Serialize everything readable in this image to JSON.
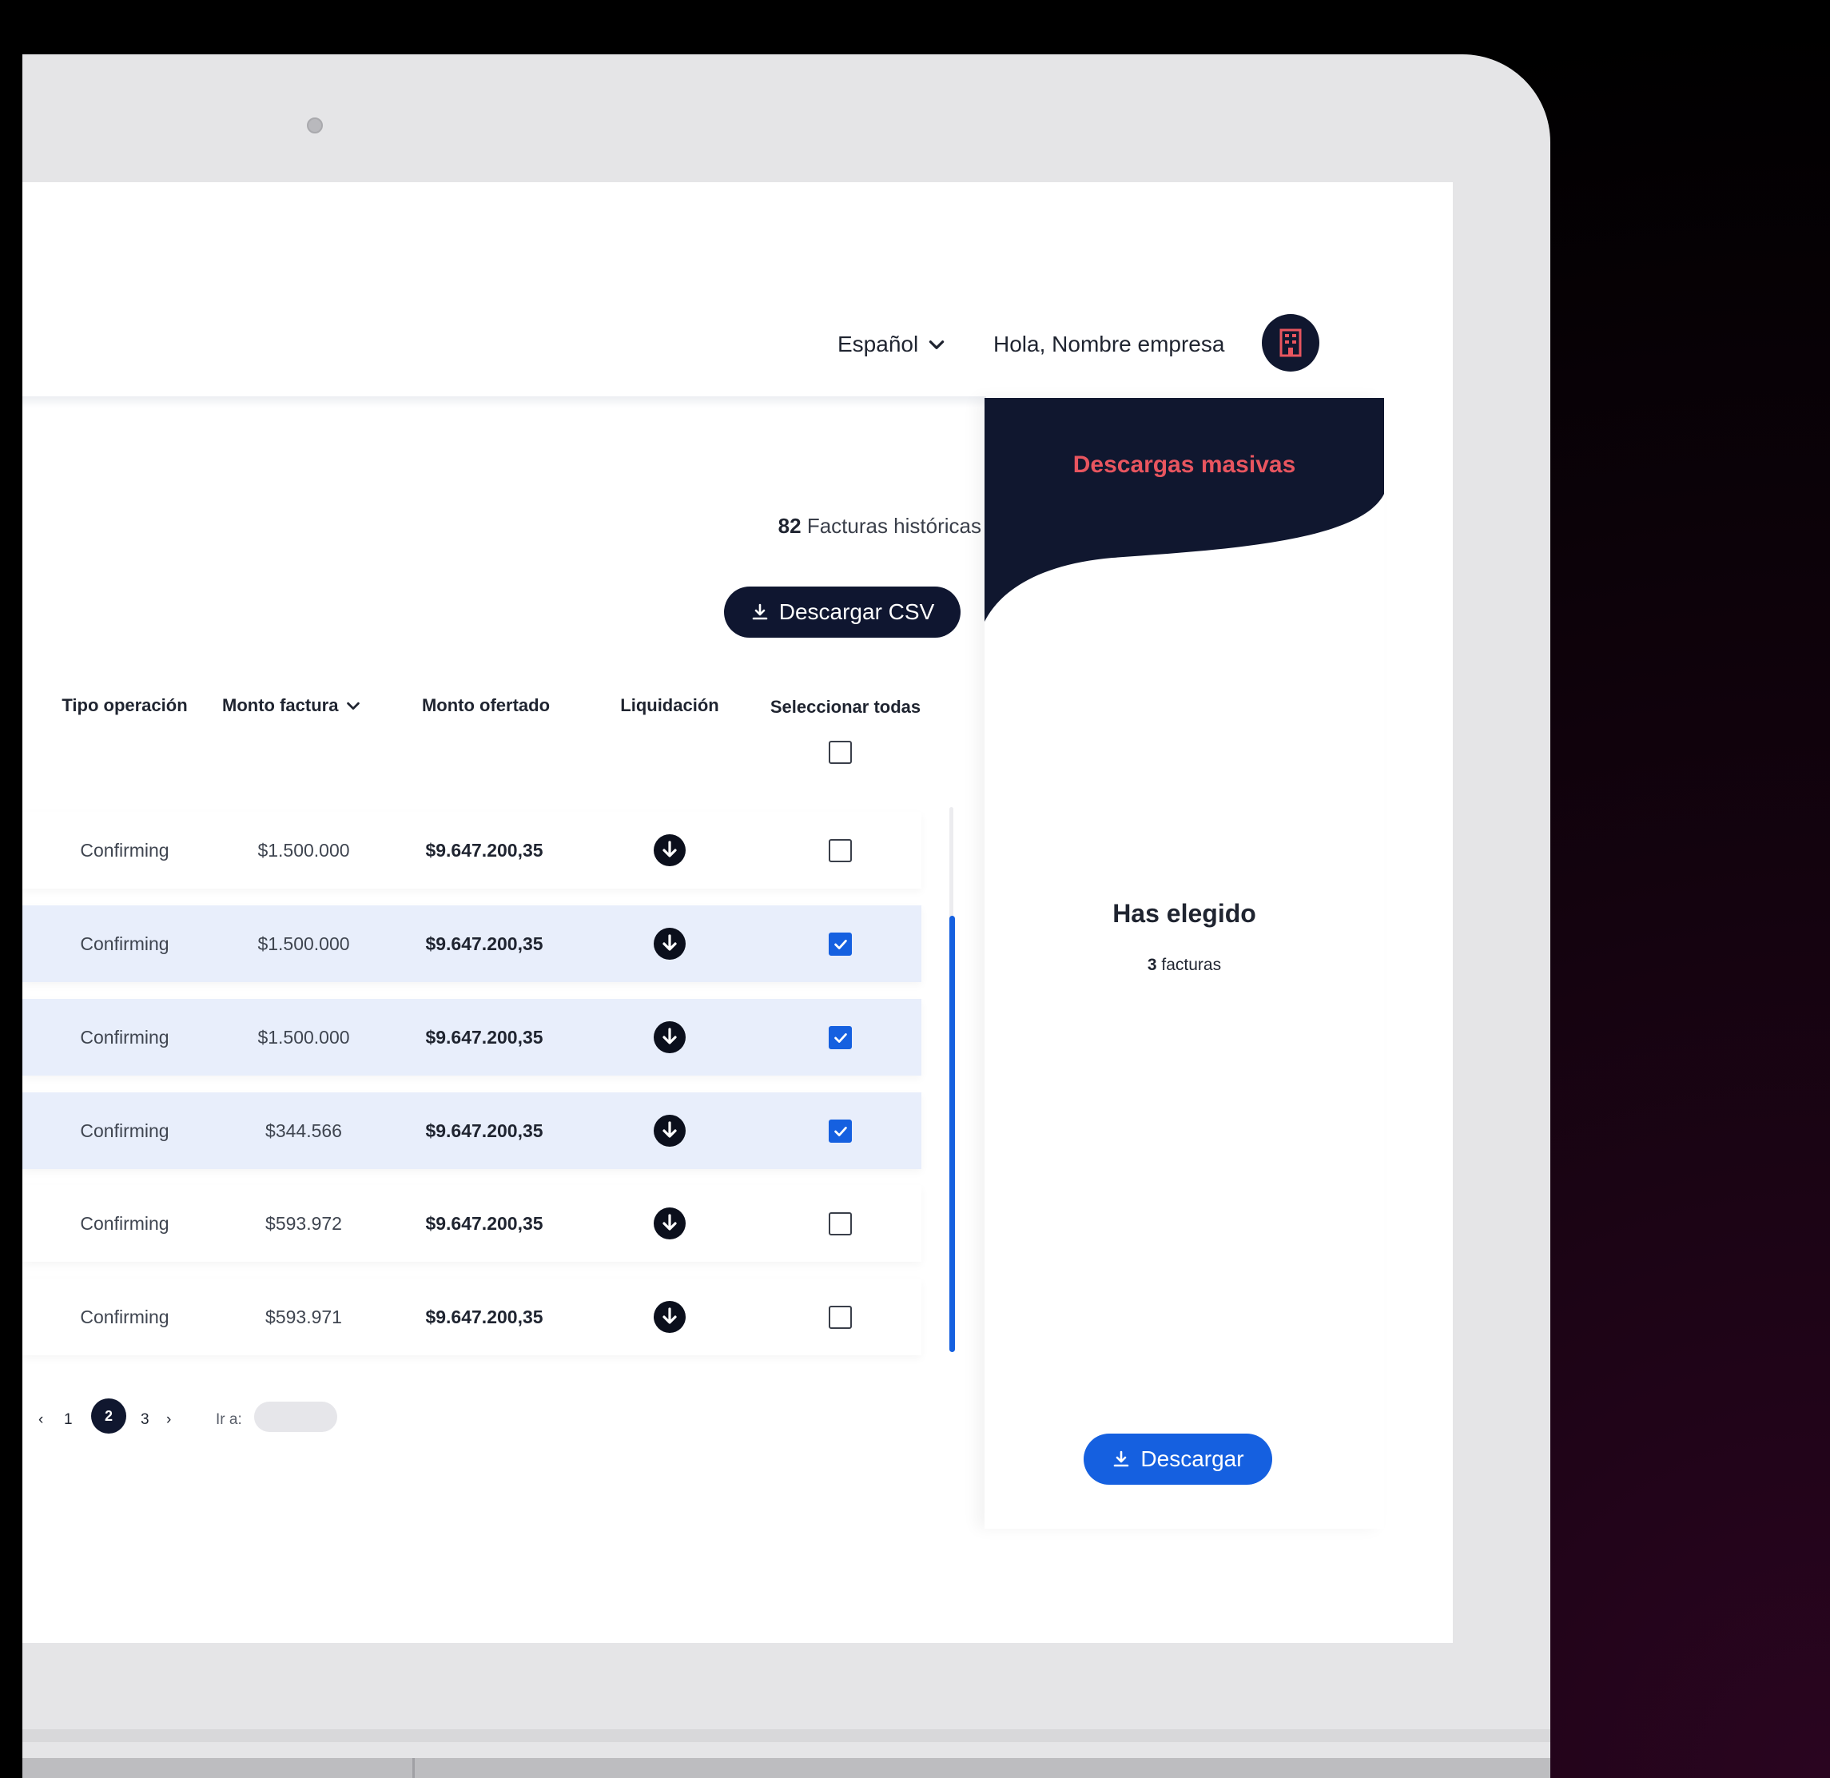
{
  "header": {
    "language": "Español",
    "greeting": "Hola, Nombre empresa"
  },
  "summary": {
    "count": "82",
    "count_label": "Facturas históricas",
    "csv_button": "Descargar CSV"
  },
  "table": {
    "columns": [
      "Tipo operación",
      "Monto factura",
      "Monto ofertado",
      "Liquidación",
      "Seleccionar todas"
    ],
    "rows": [
      {
        "tipo": "Confirming",
        "monto_factura": "$1.500.000",
        "monto_ofertado": "$9.647.200,35",
        "selected": false
      },
      {
        "tipo": "Confirming",
        "monto_factura": "$1.500.000",
        "monto_ofertado": "$9.647.200,35",
        "selected": true
      },
      {
        "tipo": "Confirming",
        "monto_factura": "$1.500.000",
        "monto_ofertado": "$9.647.200,35",
        "selected": true
      },
      {
        "tipo": "Confirming",
        "monto_factura": "$344.566",
        "monto_ofertado": "$9.647.200,35",
        "selected": true
      },
      {
        "tipo": "Confirming",
        "monto_factura": "$593.972",
        "monto_ofertado": "$9.647.200,35",
        "selected": false
      },
      {
        "tipo": "Confirming",
        "monto_factura": "$593.971",
        "monto_ofertado": "$9.647.200,35",
        "selected": false
      }
    ]
  },
  "pagination": {
    "prev": "‹",
    "pages": [
      "1",
      "2",
      "3"
    ],
    "current": "2",
    "next": "›",
    "goto_label": "Ir a:"
  },
  "panel": {
    "title": "Descargas masivas",
    "chosen_title": "Has elegido",
    "chosen_count": "3",
    "chosen_unit": "facturas",
    "download_button": "Descargar"
  },
  "colors": {
    "navy": "#10172f",
    "accent_blue": "#1560e0",
    "panel_title": "#e8555f",
    "selected_row": "#e8eefb"
  }
}
